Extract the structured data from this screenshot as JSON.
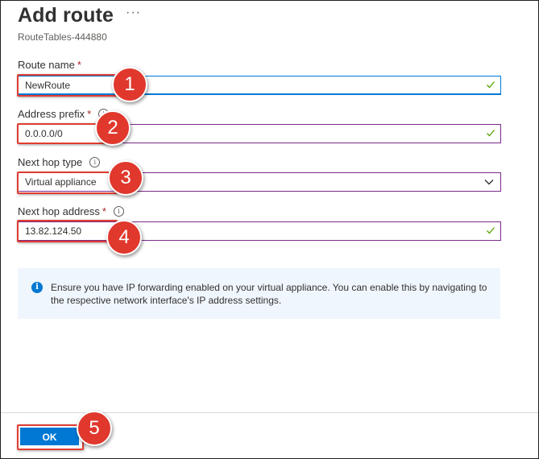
{
  "header": {
    "title": "Add route",
    "more_glyph": "···",
    "subtitle": "RouteTables-444880"
  },
  "fields": {
    "route_name": {
      "label": "Route name",
      "required": "*",
      "value": "NewRoute"
    },
    "address_prefix": {
      "label": "Address prefix",
      "required": "*",
      "info": "i",
      "value": "0.0.0.0/0"
    },
    "next_hop_type": {
      "label": "Next hop type",
      "info": "i",
      "value": "Virtual appliance"
    },
    "next_hop_address": {
      "label": "Next hop address",
      "required": "*",
      "info": "i",
      "value": "13.82.124.50"
    }
  },
  "info_message": {
    "icon": "info-icon",
    "text": "Ensure you have IP forwarding enabled on your virtual appliance. You can enable this by navigating to the respective network interface's IP address settings."
  },
  "footer": {
    "ok_label": "OK"
  },
  "annotations": {
    "step1": "1",
    "step2": "2",
    "step3": "3",
    "step4": "4",
    "step5": "5"
  },
  "colors": {
    "accent": "#0078d4",
    "valid_check": "#57a300",
    "field_border": "#7a2a8a",
    "annotation_red": "#e0382d"
  }
}
